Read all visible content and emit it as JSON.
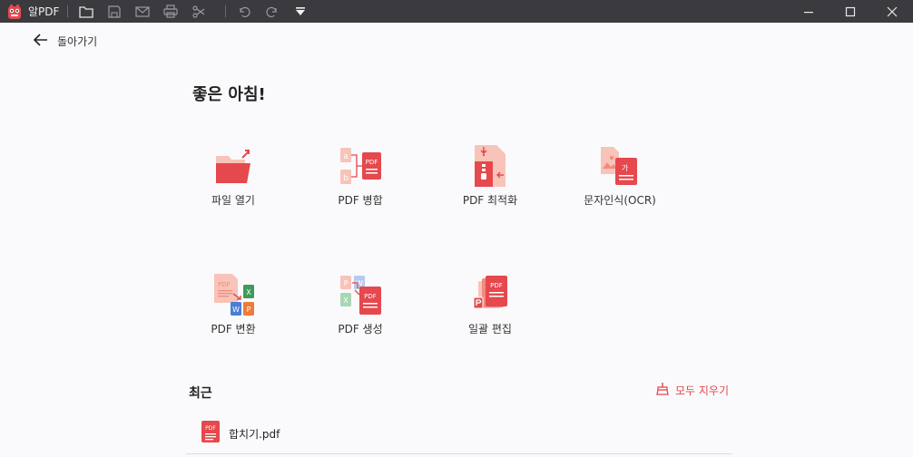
{
  "titlebar": {
    "app_name": "알PDF",
    "toolbar_icons": [
      "folder-icon",
      "save-icon",
      "mail-icon",
      "print-icon",
      "scissors-icon",
      "undo-icon",
      "redo-icon",
      "dropdown-icon"
    ],
    "window_controls": [
      "minimize-icon",
      "maximize-icon",
      "close-icon"
    ]
  },
  "nav": {
    "back_label": "돌아가기"
  },
  "greeting": "좋은 아침!",
  "tools": [
    {
      "label": "파일 열기",
      "icon": "open-folder-icon"
    },
    {
      "label": "PDF 병합",
      "icon": "merge-pdf-icon"
    },
    {
      "label": "PDF 최적화",
      "icon": "compress-pdf-icon"
    },
    {
      "label": "문자인식(OCR)",
      "icon": "ocr-icon"
    },
    {
      "label": "PDF 변환",
      "icon": "convert-pdf-icon"
    },
    {
      "label": "PDF 생성",
      "icon": "create-pdf-icon"
    },
    {
      "label": "일괄 편집",
      "icon": "batch-edit-icon"
    }
  ],
  "recent": {
    "title": "최근",
    "clear_label": "모두 지우기",
    "items": [
      {
        "name": "합치기.pdf"
      }
    ]
  },
  "colors": {
    "accent": "#e5484d",
    "titlebar": "#3b3b3f",
    "background": "#fafafc"
  }
}
